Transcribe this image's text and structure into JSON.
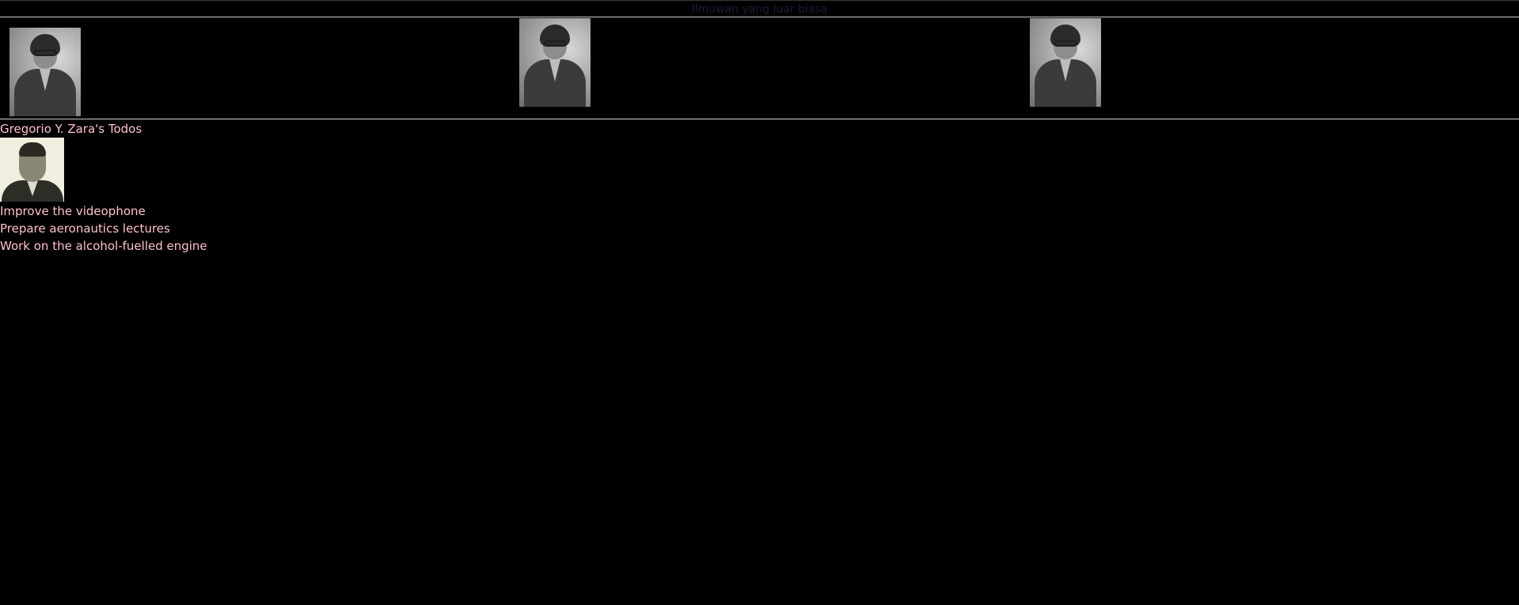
{
  "header": {
    "title": "Ilmuwan yang luar biasa"
  },
  "gallery": {
    "images": [
      {
        "icon": "portrait-photo"
      },
      {
        "icon": "portrait-photo"
      },
      {
        "icon": "portrait-photo"
      }
    ]
  },
  "profile": {
    "heading": "Gregorio Y. Zara's Todos",
    "avatar_icon": "portrait-photo"
  },
  "todos": [
    "Improve the videophone",
    "Prepare aeronautics lectures",
    "Work on the alcohol-fuelled engine"
  ],
  "colors": {
    "background": "#000000",
    "text": "#ffc0cb",
    "title_text": "#1b1b3a"
  }
}
